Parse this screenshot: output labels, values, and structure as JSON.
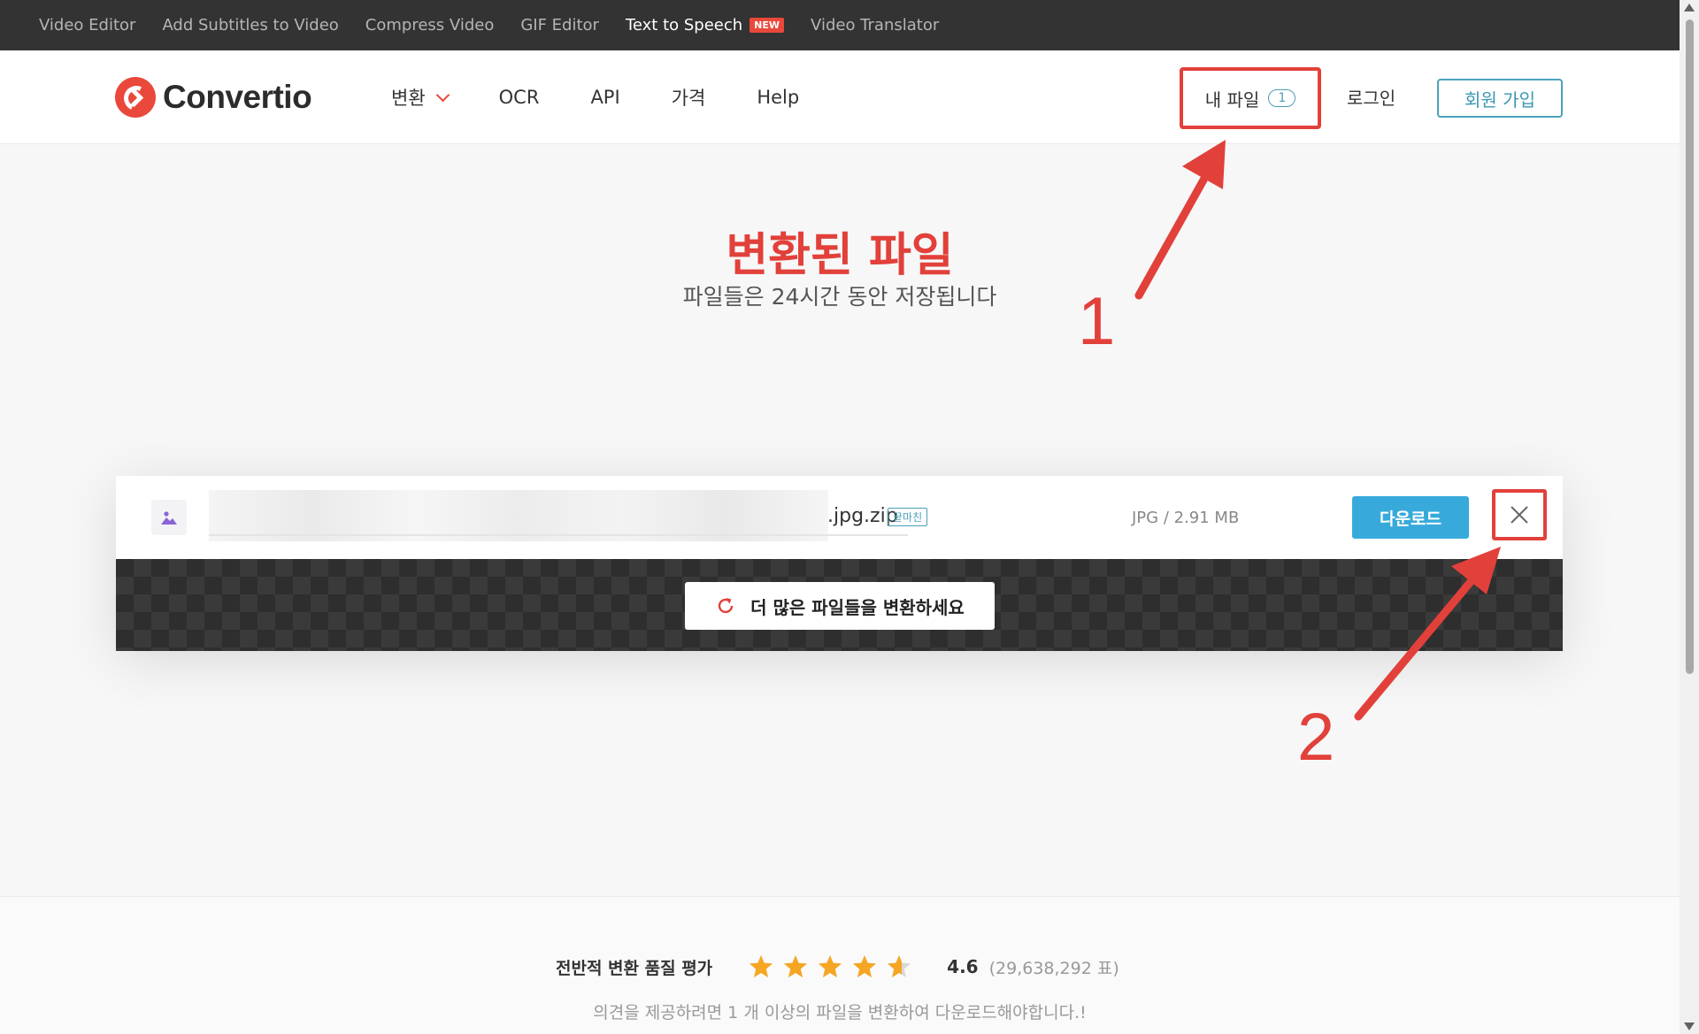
{
  "topbar": {
    "links": [
      "Video Editor",
      "Add Subtitles to Video",
      "Compress Video",
      "GIF Editor",
      "Text to Speech",
      "Video Translator"
    ],
    "new_badge": "NEW"
  },
  "header": {
    "logo_text": "Convertio",
    "nav": [
      "변환",
      "OCR",
      "API",
      "가격",
      "Help"
    ],
    "my_files": "내 파일",
    "my_files_count": "1",
    "login": "로그인",
    "signup": "회원 가입"
  },
  "hero": {
    "title": "변환된 파일",
    "subtitle": "파일들은 24시간 동안 저장됩니다"
  },
  "file": {
    "name_suffix": ".jpg.zip",
    "status": "끝마친",
    "meta": "JPG / 2.91 MB",
    "download_label": "다운로드",
    "convert_more": "더 많은 파일들을 변환하세요"
  },
  "rating": {
    "label": "전반적 변환 품질 평가",
    "score": "4.6",
    "score_value": 4.6,
    "votes": "(29,638,292 표)",
    "note": "의견을 제공하려면 1 개 이상의 파일을 변환하여 다운로드해야합니다.!"
  },
  "annotations": {
    "label_1": "1",
    "label_2": "2"
  },
  "colors": {
    "accent_red": "#e2403a",
    "download_blue": "#37aadb",
    "teal": "#4aa3ba",
    "star_gold": "#f6a623",
    "dark_bar": "#333333"
  },
  "icons": [
    "image-file-icon",
    "close-icon",
    "refresh-icon",
    "star-icon",
    "chevron-down-icon",
    "arrow-annotation-icon"
  ]
}
